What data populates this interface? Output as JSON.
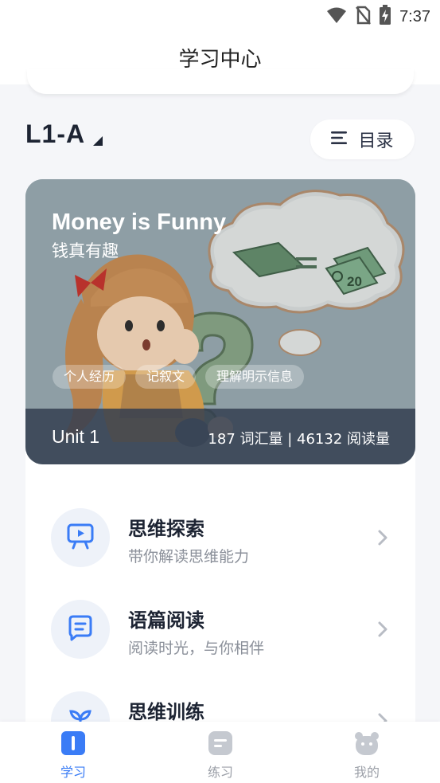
{
  "status_bar": {
    "time": "7:37"
  },
  "header": {
    "title": "学习中心"
  },
  "level": {
    "label": "L1-A"
  },
  "catalog_button": {
    "label": "目录"
  },
  "unit_card": {
    "title": "Money is Funny",
    "subtitle": "钱真有趣",
    "tags": [
      "个人经历",
      "记叙文",
      "理解明示信息"
    ],
    "unit_label": "Unit 1",
    "stats": "187 词汇量 | 46132 阅读量",
    "illustration_text": "20"
  },
  "modules": [
    {
      "title": "思维探索",
      "desc": "带你解读思维能力",
      "icon": "presentation-play-icon"
    },
    {
      "title": "语篇阅读",
      "desc": "阅读时光，与你相伴",
      "icon": "chat-bubble-icon"
    },
    {
      "title": "思维训练",
      "desc": "",
      "icon": "sprout-icon"
    }
  ],
  "tab_bar": {
    "active": "study",
    "tabs": [
      {
        "label": "学习",
        "icon": "book-icon"
      },
      {
        "label": "练习",
        "icon": "practice-icon"
      },
      {
        "label": "我的",
        "icon": "profile-icon"
      }
    ]
  },
  "colors": {
    "accent": "#3a7cf6",
    "dark_text": "#1d2433",
    "muted_text": "#8a8f99",
    "background": "#f5f6f9"
  }
}
